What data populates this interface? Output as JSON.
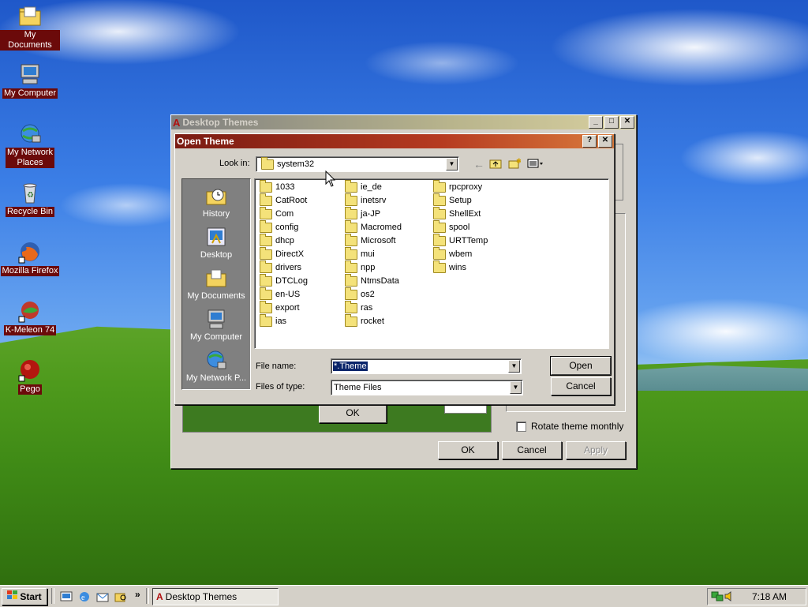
{
  "desktop": {
    "icons": [
      {
        "label": "My Documents",
        "icon": "folder-documents-icon"
      },
      {
        "label": "My Computer",
        "icon": "computer-icon"
      },
      {
        "label": "My Network Places",
        "label_line1": "My Network",
        "label_line2": "Places",
        "icon": "network-icon"
      },
      {
        "label": "Recycle Bin",
        "icon": "recycle-bin-icon"
      },
      {
        "label": "Mozilla Firefox",
        "icon": "firefox-icon"
      },
      {
        "label": "K-Meleon 74",
        "icon": "k-meleon-icon"
      },
      {
        "label": "Pego",
        "icon": "pego-icon"
      }
    ]
  },
  "themes_window": {
    "title": "Desktop Themes",
    "ok_label": "OK",
    "cancel_label": "Cancel",
    "apply_label": "Apply",
    "rotate_label": "Rotate theme monthly",
    "rotate_checked": false,
    "behind_ok_label": "OK"
  },
  "open_dialog": {
    "title": "Open Theme",
    "help_label": "?",
    "close_label": "✕",
    "look_in_label": "Look in:",
    "look_in_value": "system32",
    "places": [
      {
        "label": "History"
      },
      {
        "label": "Desktop"
      },
      {
        "label": "My Documents"
      },
      {
        "label": "My Computer"
      },
      {
        "label": "My Network P..."
      }
    ],
    "folders": [
      [
        "1033",
        "CatRoot",
        "Com",
        "config",
        "dhcp",
        "DirectX",
        "drivers",
        "DTCLog",
        "en-US",
        "export",
        "ias"
      ],
      [
        "ie_de",
        "inetsrv",
        "ja-JP",
        "Macromed",
        "Microsoft",
        "mui",
        "npp",
        "NtmsData",
        "os2",
        "ras",
        "rocket"
      ],
      [
        "rpcproxy",
        "Setup",
        "ShellExt",
        "spool",
        "URTTemp",
        "wbem",
        "wins"
      ]
    ],
    "file_name_label": "File name:",
    "file_name_value": "*.Theme",
    "files_of_type_label": "Files of type:",
    "files_of_type_value": "Theme Files",
    "open_label": "Open",
    "cancel_label": "Cancel"
  },
  "taskbar": {
    "start_label": "Start",
    "quicklaunch_more": "»",
    "task_label": "Desktop Themes",
    "clock": "7:18 AM"
  }
}
